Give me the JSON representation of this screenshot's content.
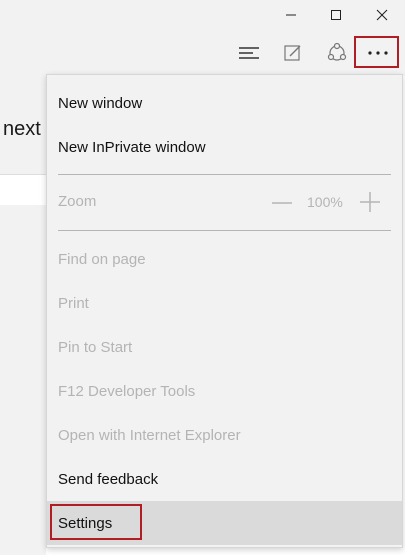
{
  "window": {
    "minimize_icon": "minimize-icon",
    "maximize_icon": "maximize-icon",
    "close_icon": "close-icon"
  },
  "toolbar": {
    "icons": [
      "hub-icon",
      "web-note-icon",
      "share-icon",
      "more-actions-icon"
    ]
  },
  "page": {
    "visible_text": "next"
  },
  "menu": {
    "new_window": "New window",
    "new_inprivate_window": "New InPrivate window",
    "zoom_label": "Zoom",
    "zoom_value": "100%",
    "find_on_page": "Find on page",
    "print": "Print",
    "pin_to_start": "Pin to Start",
    "f12_tools": "F12 Developer Tools",
    "open_with_ie": "Open with Internet Explorer",
    "send_feedback": "Send feedback",
    "settings": "Settings"
  },
  "colors": {
    "highlight_border": "#b01e23",
    "menu_background": "#f2f2f2",
    "disabled_text": "#b4b4b4",
    "hover_background": "#dadada"
  }
}
